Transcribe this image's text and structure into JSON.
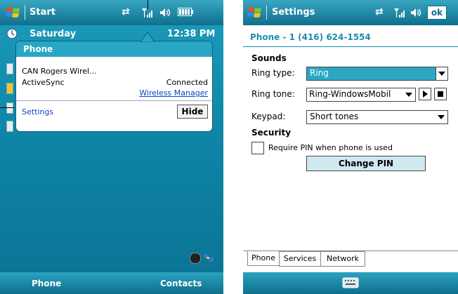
{
  "left": {
    "title": "Start",
    "day": "Saturday",
    "time": "12:38 PM",
    "popup": {
      "title": "Phone",
      "carrier": "CAN Rogers Wirel...",
      "activesync_label": "ActiveSync",
      "activesync_status": "Connected",
      "wireless_manager": "Wireless Manager",
      "settings": "Settings",
      "hide": "Hide"
    },
    "softkeys": {
      "left": "Phone",
      "right": "Contacts"
    }
  },
  "right": {
    "title": "Settings",
    "ok": "ok",
    "phone_number": "Phone - 1 (416) 624-1554",
    "sounds": {
      "heading": "Sounds",
      "ring_type_label": "Ring type:",
      "ring_type_value": "Ring",
      "ring_tone_label": "Ring tone:",
      "ring_tone_value": "Ring-WindowsMobil",
      "keypad_label": "Keypad:",
      "keypad_value": "Short tones"
    },
    "security": {
      "heading": "Security",
      "require_pin": "Require PIN when phone is used",
      "change_pin": "Change PIN"
    },
    "tabs": [
      "Phone",
      "Services",
      "Network"
    ]
  },
  "colors": {
    "accent": "#29a6c4",
    "link": "#0b42c8",
    "today_bg": "#128aa8"
  }
}
